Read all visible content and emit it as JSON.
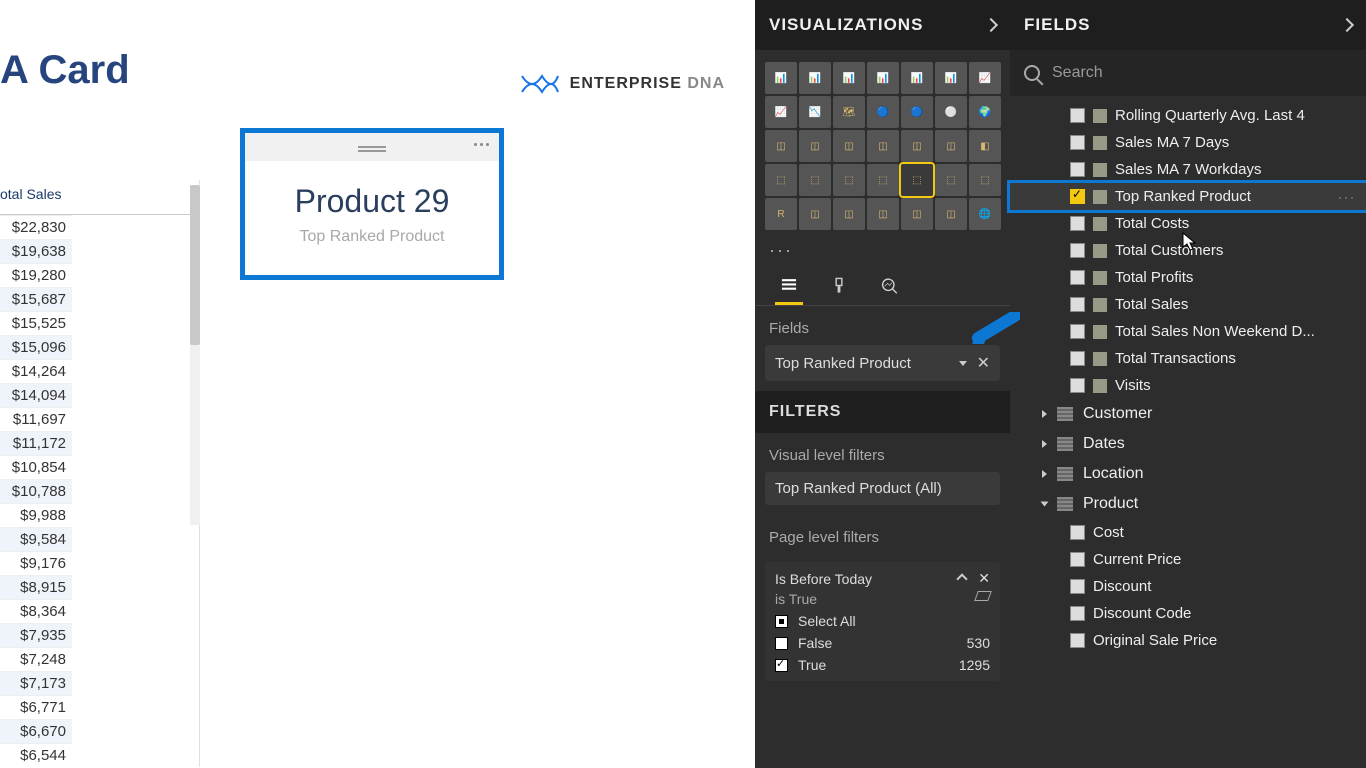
{
  "page_title": "A Card",
  "logo_text_a": "ENTERPRISE ",
  "logo_text_b": "DNA",
  "table": {
    "header": "otal Sales",
    "rows": [
      "$22,830",
      "$19,638",
      "$19,280",
      "$15,687",
      "$15,525",
      "$15,096",
      "$14,264",
      "$14,094",
      "$11,697",
      "$11,172",
      "$10,854",
      "$10,788",
      "$9,988",
      "$9,584",
      "$9,176",
      "$8,915",
      "$8,364",
      "$7,935",
      "$7,248",
      "$7,173",
      "$6,771",
      "$6,670",
      "$6,544"
    ]
  },
  "card": {
    "value": "Product 29",
    "label": "Top Ranked Product"
  },
  "viz": {
    "header": "VISUALIZATIONS",
    "fields_label": "Fields",
    "well_value": "Top Ranked Product",
    "filters_header": "FILTERS",
    "vlf_label": "Visual level filters",
    "vlf_value": "Top Ranked Product (All)",
    "plf_label": "Page level filters",
    "filter2": {
      "title": "Is Before Today",
      "sub": "is True",
      "opt_all": "Select All",
      "opt_false": "False",
      "cnt_false": "530",
      "opt_true": "True",
      "cnt_true": "1295"
    }
  },
  "fields": {
    "header": "FIELDS",
    "search_placeholder": "Search",
    "measures": [
      {
        "label": "Rolling Quarterly Avg. Last 4",
        "checked": false
      },
      {
        "label": "Sales MA 7 Days",
        "checked": false
      },
      {
        "label": "Sales MA 7 Workdays",
        "checked": false
      },
      {
        "label": "Top Ranked Product",
        "checked": true,
        "highlight": true
      },
      {
        "label": "Total Costs",
        "checked": false
      },
      {
        "label": "Total Customers",
        "checked": false
      },
      {
        "label": "Total Profits",
        "checked": false
      },
      {
        "label": "Total Sales",
        "checked": false
      },
      {
        "label": "Total Sales Non Weekend D...",
        "checked": false
      },
      {
        "label": "Total Transactions",
        "checked": false
      },
      {
        "label": "Visits",
        "checked": false
      }
    ],
    "tables": [
      {
        "name": "Customer",
        "expanded": false
      },
      {
        "name": "Dates",
        "expanded": false
      },
      {
        "name": "Location",
        "expanded": false
      },
      {
        "name": "Product",
        "expanded": true,
        "cols": [
          "Cost",
          "Current Price",
          "Discount",
          "Discount Code",
          "Original Sale Price"
        ]
      }
    ]
  }
}
